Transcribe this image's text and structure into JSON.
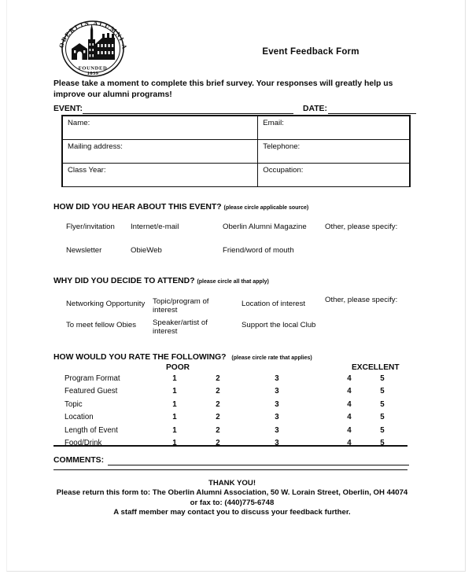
{
  "document": {
    "title": "Event Feedback Form",
    "logo": {
      "icon": "oberlin-alumni-association-seal",
      "ring_text_left": "OBERLIN",
      "ring_text_top": "ALUMNI",
      "ring_text_right": "ASSOCIATION",
      "founded_label": "FOUNDED",
      "founded_year": "1839"
    },
    "intro": "Please take a moment to complete this brief survey.  Your responses will greatly help us improve our alumni programs!"
  },
  "event_line": {
    "event_label": "EVENT:",
    "event_value": "",
    "date_label": "DATE:",
    "date_value": ""
  },
  "info_table": {
    "rows": [
      {
        "left_label": "Name:",
        "left_value": "",
        "right_label": "Email:",
        "right_value": ""
      },
      {
        "left_label": "Mailing address:",
        "left_value": "",
        "right_label": "Telephone:",
        "right_value": ""
      },
      {
        "left_label": "Class Year:",
        "left_value": "",
        "right_label": "Occupation:",
        "right_value": ""
      }
    ]
  },
  "hear_about": {
    "heading": "HOW DID YOU HEAR ABOUT THIS EVENT?",
    "hint": "(please circle applicable source)",
    "options": [
      "Flyer/invitation",
      "Internet/e-mail",
      "Oberlin Alumni Magazine",
      "Other, please specify:",
      "Newsletter",
      "ObieWeb",
      "Friend/word of mouth"
    ]
  },
  "decide_attend": {
    "heading": "WHY DID YOU DECIDE TO ATTEND?",
    "hint": "(please circle all that apply)",
    "options": [
      "Networking Opportunity",
      "Topic/program of interest",
      "Location of interest",
      "Other, please specify:",
      "To meet fellow Obies",
      "Speaker/artist of interest",
      "Support the local Club"
    ]
  },
  "rating": {
    "heading": "HOW WOULD YOU RATE THE FOLLOWING?",
    "hint": "(please circle rate that applies)",
    "low_label": "POOR",
    "high_label": "EXCELLENT",
    "scale": [
      "1",
      "2",
      "3",
      "4",
      "5"
    ],
    "items": [
      "Program Format",
      "Featured Guest",
      "Topic",
      "Location",
      "Length of Event",
      "Food/Drink"
    ]
  },
  "comments": {
    "label": "COMMENTS:",
    "value": ""
  },
  "footer": {
    "thanks": "THANK YOU!",
    "return_line": "Please return this form to:  The Oberlin Alumni Association, 50 W. Lorain Street, Oberlin, OH 44074",
    "fax_line": "or fax to: (440)775-6748",
    "contact_line": "A staff member may contact you to discuss your feedback further."
  }
}
